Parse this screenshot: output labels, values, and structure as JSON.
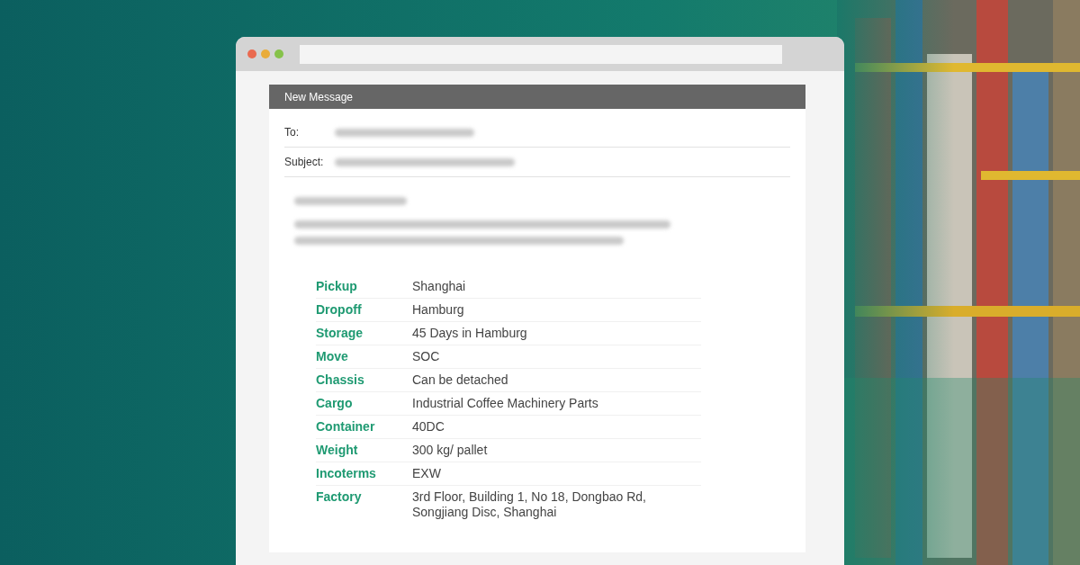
{
  "message": {
    "title": "New Message",
    "fields": [
      {
        "label": "To:",
        "blurred": true
      },
      {
        "label": "Subject:",
        "blurred": true
      }
    ],
    "body": {
      "blurred": true
    },
    "details": [
      {
        "label": "Pickup",
        "value": "Shanghai"
      },
      {
        "label": "Dropoff",
        "value": "Hamburg"
      },
      {
        "label": "Storage",
        "value": "45 Days in Hamburg"
      },
      {
        "label": "Move",
        "value": "SOC"
      },
      {
        "label": "Chassis",
        "value": "Can be detached"
      },
      {
        "label": "Cargo",
        "value": "Industrial Coffee Machinery Parts"
      },
      {
        "label": "Container",
        "value": "40DC"
      },
      {
        "label": "Weight",
        "value": "300 kg/ pallet"
      },
      {
        "label": "Incoterms",
        "value": "EXW"
      },
      {
        "label": "Factory",
        "value": "3rd Floor, Building 1, No 18, Dongbao Rd, Songjiang Disc, Shanghai"
      }
    ]
  }
}
